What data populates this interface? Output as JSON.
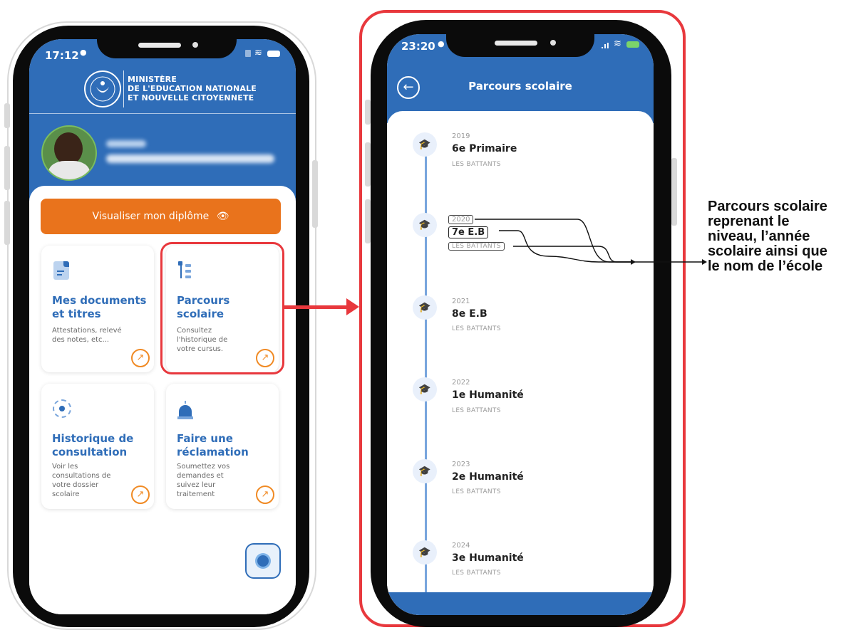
{
  "left_phone": {
    "status_time": "17:12",
    "ministry_lines": [
      "MINISTÈRE",
      "DE L'EDUCATION NATIONALE",
      "ET NOUVELLE CITOYENNETE"
    ],
    "diploma_button": "Visualiser mon diplôme",
    "cards": [
      {
        "title": "Mes documents et titres",
        "desc": "Attestations, relevé des notes, etc..."
      },
      {
        "title": "Parcours scolaire",
        "desc": "Consultez l'historique de votre cursus."
      },
      {
        "title": "Historique de consultation",
        "desc": "Voir les consultations de votre dossier scolaire"
      },
      {
        "title": "Faire une réclamation",
        "desc": "Soumettez vos demandes et suivez leur traitement"
      }
    ]
  },
  "right_phone": {
    "status_time": "23:20",
    "header_title": "Parcours scolaire",
    "timeline": [
      {
        "year": "2019",
        "level": "6e Primaire",
        "school": "LES BATTANTS"
      },
      {
        "year": "2020",
        "level": "7e E.B",
        "school": "LES BATTANTS"
      },
      {
        "year": "2021",
        "level": "8e E.B",
        "school": "LES BATTANTS"
      },
      {
        "year": "2022",
        "level": "1e Humanité",
        "school": "LES BATTANTS"
      },
      {
        "year": "2023",
        "level": "2e Humanité",
        "school": "LES BATTANTS"
      },
      {
        "year": "2024",
        "level": "3e Humanité",
        "school": "LES BATTANTS"
      }
    ]
  },
  "annotation": "Parcours scolaire reprenant le niveau, l’année scolaire ainsi que le nom de l’école",
  "colors": {
    "primary_blue": "#2f6db8",
    "accent_orange": "#e9731c",
    "highlight_red": "#e8383d"
  }
}
